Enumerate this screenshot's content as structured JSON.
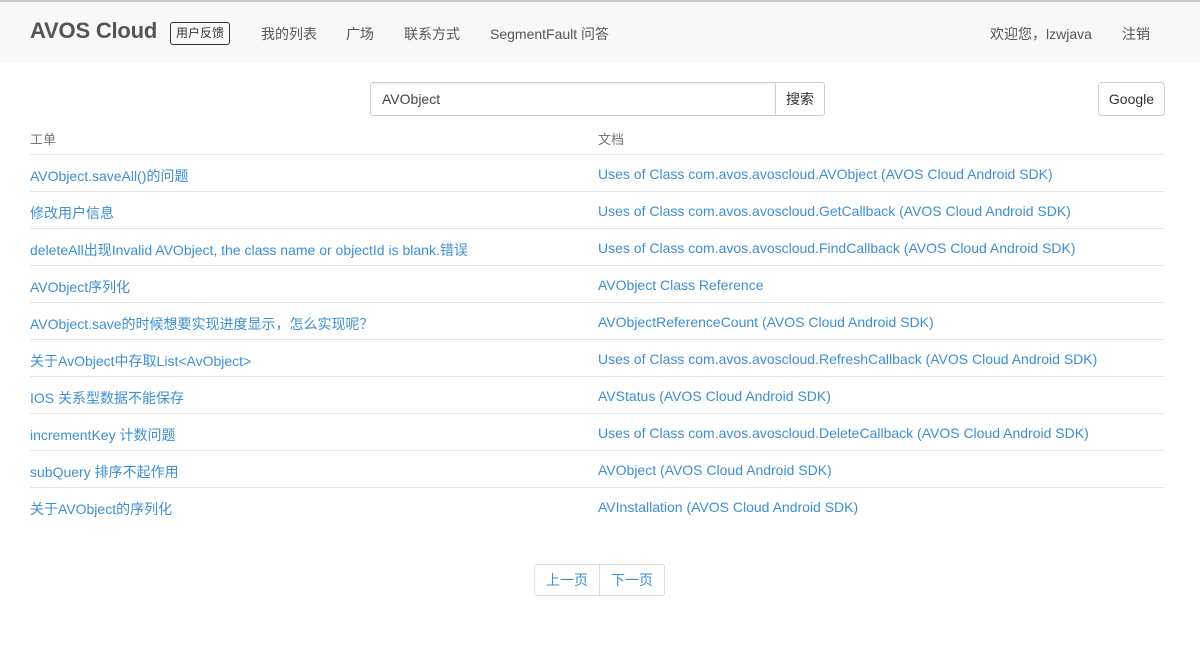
{
  "navbar": {
    "brand": "AVOS Cloud",
    "feedback_badge": "用户反馈",
    "links": [
      "我的列表",
      "广场",
      "联系方式",
      "SegmentFault 问答"
    ],
    "welcome": "欢迎您，lzwjava",
    "logout": "注销"
  },
  "search": {
    "value": "AVObject",
    "button": "搜索",
    "google": "Google"
  },
  "table": {
    "headers": [
      "工单",
      "文档"
    ],
    "tickets": [
      "AVObject.saveAll()的问题",
      "修改用户信息",
      "deleteAll出现Invalid AVObject, the class name or objectId is blank.错误",
      "AVObject序列化",
      "AVObject.save的时候想要实现进度显示，怎么实现呢？",
      "关于AvObject中存取List<AvObject>",
      "IOS 关系型数据不能保存",
      "incrementKey 计数问题",
      "subQuery 排序不起作用",
      "关于AVObject的序列化"
    ],
    "docs": [
      "Uses of Class com.avos.avoscloud.AVObject (AVOS Cloud Android SDK)",
      "Uses of Class com.avos.avoscloud.GetCallback (AVOS Cloud Android SDK)",
      "Uses of Class com.avos.avoscloud.FindCallback (AVOS Cloud Android SDK)",
      "AVObject Class Reference",
      "AVObjectReferenceCount (AVOS Cloud Android SDK)",
      "Uses of Class com.avos.avoscloud.RefreshCallback (AVOS Cloud Android SDK)",
      "AVStatus (AVOS Cloud Android SDK)",
      "Uses of Class com.avos.avoscloud.DeleteCallback (AVOS Cloud Android SDK)",
      "AVObject (AVOS Cloud Android SDK)",
      "AVInstallation (AVOS Cloud Android SDK)"
    ]
  },
  "pager": {
    "prev": "上一页",
    "next": "下一页"
  },
  "colors": {
    "link": "#3d8fd1",
    "navbar_bg": "#f8f8f8",
    "border": "#e6e6e6"
  }
}
